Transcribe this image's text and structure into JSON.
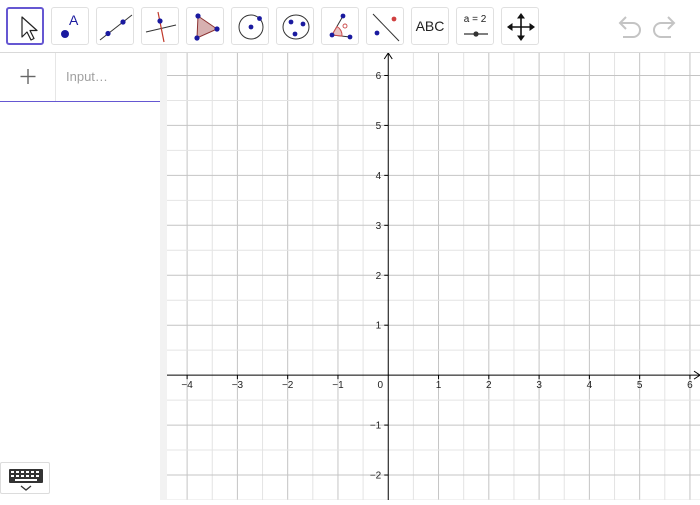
{
  "toolbar": {
    "tools": [
      {
        "name": "move-tool",
        "selected": true
      },
      {
        "name": "point-tool"
      },
      {
        "name": "line-tool"
      },
      {
        "name": "perpendicular-line-tool"
      },
      {
        "name": "polygon-tool"
      },
      {
        "name": "circle-center-point-tool"
      },
      {
        "name": "circle-three-points-tool"
      },
      {
        "name": "angle-tool"
      },
      {
        "name": "reflect-about-line-tool"
      },
      {
        "name": "text-tool",
        "label": "ABC"
      },
      {
        "name": "slider-tool",
        "label": "a = 2"
      },
      {
        "name": "move-graphics-view-tool"
      }
    ],
    "point_label": "A",
    "undo_icon": "undo-icon",
    "redo_icon": "redo-icon"
  },
  "algebra": {
    "input_placeholder": "Input…",
    "add_icon": "plus-icon"
  },
  "keyboard_icon": "keyboard-icon",
  "graphics": {
    "x_ticks": [
      "−4",
      "−3",
      "−2",
      "−1",
      "0",
      "1",
      "2",
      "3",
      "4",
      "5",
      "6"
    ],
    "y_ticks": [
      "6",
      "5",
      "4",
      "3",
      "2",
      "1",
      "−1",
      "−2"
    ],
    "x_range": [
      -4.4,
      6.2
    ],
    "y_range": [
      -2.5,
      6.45
    ],
    "grid": true
  },
  "colors": {
    "accent": "#6557d2",
    "point": "#1a1a9f",
    "polygon_fill": "#d7b0b0",
    "grid": "#c8c8c8",
    "axis": "#000000",
    "angle": "#cc4a4a"
  }
}
